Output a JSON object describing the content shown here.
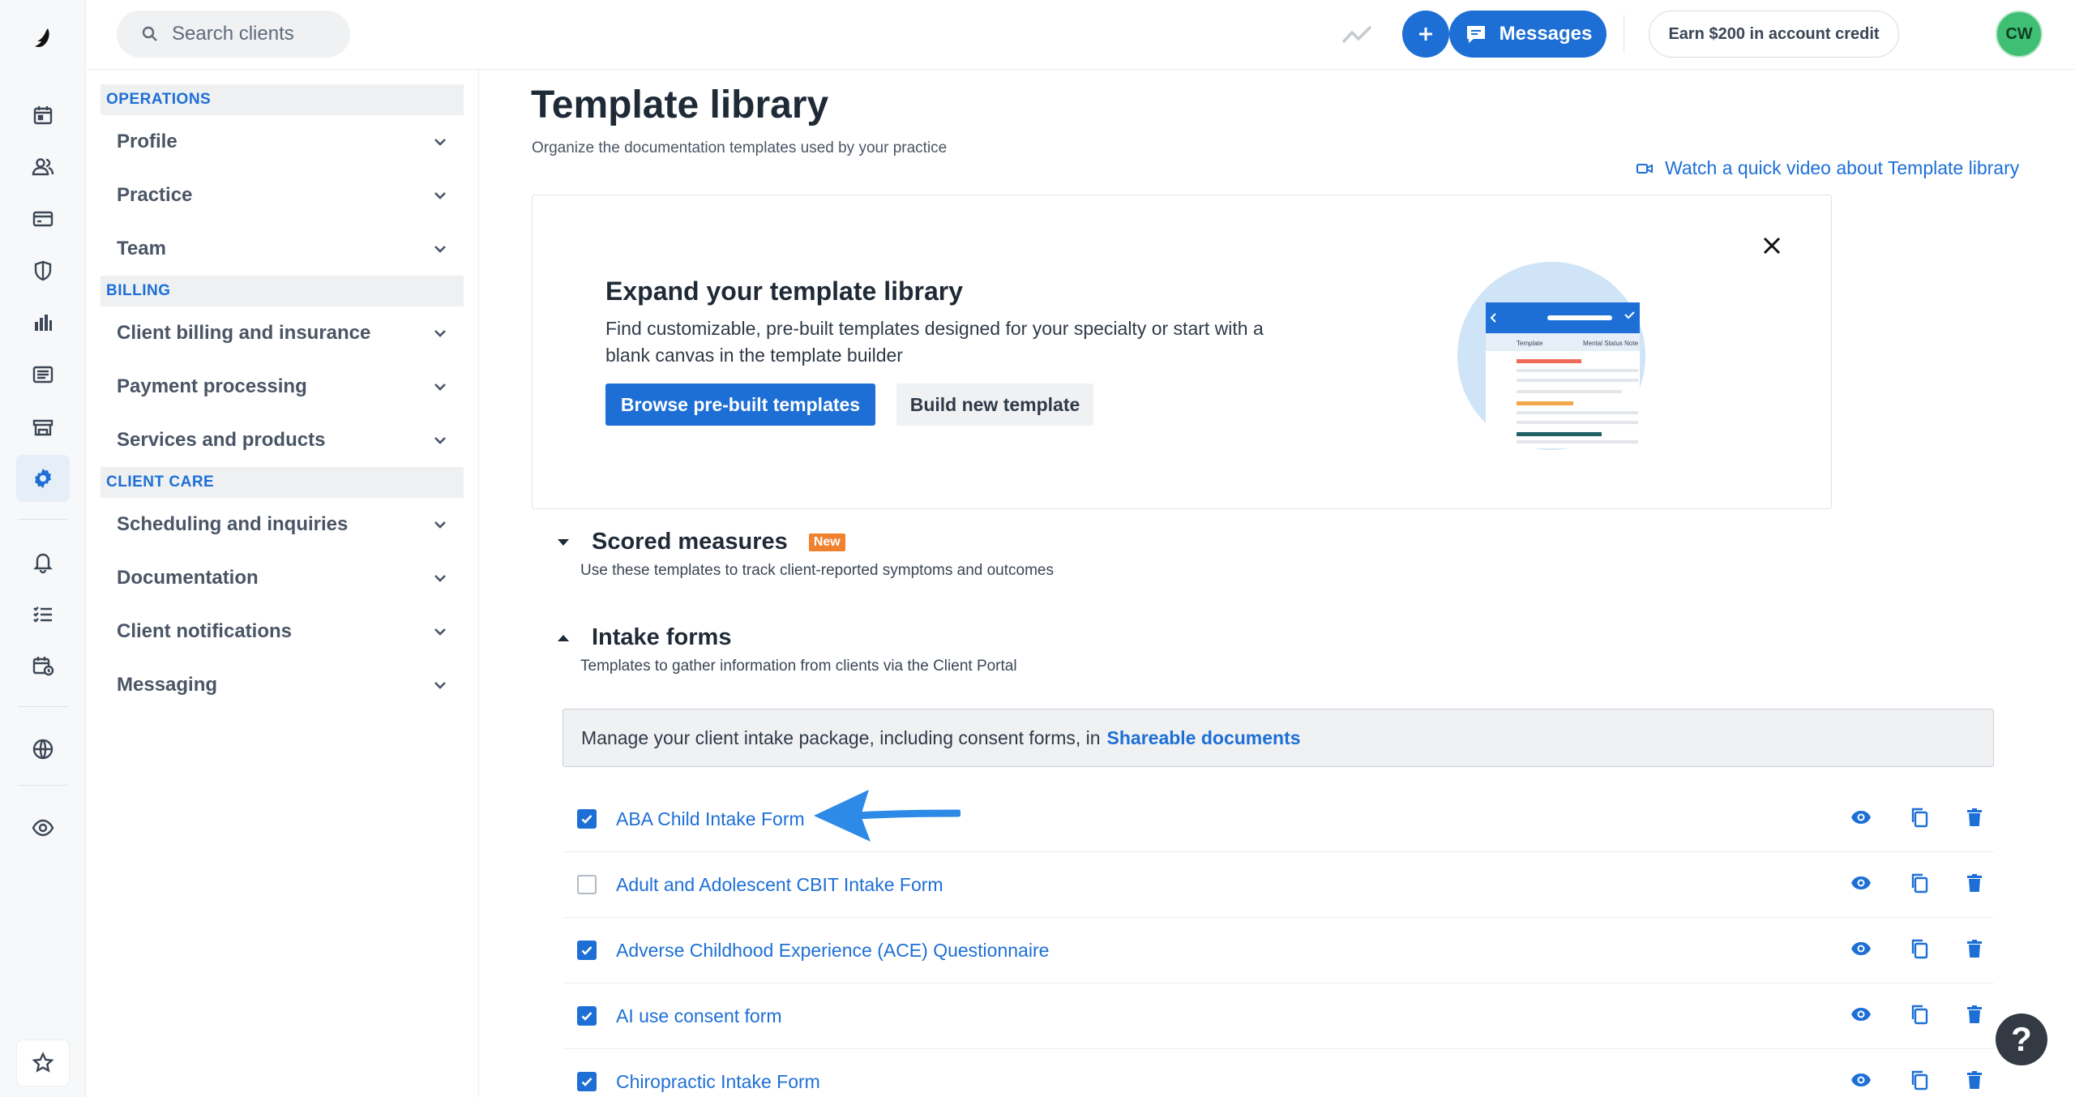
{
  "header": {
    "search_placeholder": "Search clients",
    "messages_label": "Messages",
    "earn_label": "Earn $200 in account credit",
    "avatar_initials": "CW"
  },
  "rail": {
    "icons": [
      "logo-icon",
      "calendar-icon",
      "clients-icon",
      "billing-card-icon",
      "insurance-shield-icon",
      "analytics-icon",
      "list-icon",
      "marketplace-icon",
      "settings-gear-icon",
      "notifications-bell-icon",
      "tasks-icon",
      "reminders-icon",
      "website-globe-icon",
      "view-eye-icon",
      "favorites-star-icon"
    ],
    "active": "settings-gear-icon"
  },
  "settings_nav": {
    "sections": [
      {
        "title": "OPERATIONS",
        "items": [
          {
            "label": "Profile"
          },
          {
            "label": "Practice"
          },
          {
            "label": "Team"
          }
        ]
      },
      {
        "title": "BILLING",
        "items": [
          {
            "label": "Client billing and insurance"
          },
          {
            "label": "Payment processing"
          },
          {
            "label": "Services and products"
          }
        ]
      },
      {
        "title": "CLIENT CARE",
        "items": [
          {
            "label": "Scheduling and inquiries"
          },
          {
            "label": "Documentation"
          },
          {
            "label": "Client notifications"
          },
          {
            "label": "Messaging"
          }
        ]
      }
    ]
  },
  "page": {
    "title": "Template library",
    "subtitle": "Organize the documentation templates used by your practice",
    "video_link": "Watch a quick video about Template library"
  },
  "promo": {
    "title": "Expand your template library",
    "text": "Find customizable, pre-built templates designed for your specialty or start with a blank canvas in the template builder",
    "primary_button": "Browse pre-built templates",
    "secondary_button": "Build new template",
    "illustration": {
      "col_template": "Template",
      "col_note": "Mental Status Note"
    }
  },
  "groups": {
    "scored": {
      "title": "Scored measures",
      "badge": "New",
      "description": "Use these templates to track client-reported symptoms and outcomes",
      "expanded": false
    },
    "intake": {
      "title": "Intake forms",
      "description": "Templates to gather information from clients via the Client Portal",
      "expanded": true
    }
  },
  "info_bar": {
    "text": "Manage your client intake package, including consent forms, in",
    "link": "Shareable documents"
  },
  "templates": [
    {
      "name": "ABA Child Intake Form",
      "checked": true
    },
    {
      "name": "Adult and Adolescent CBIT Intake Form",
      "checked": false
    },
    {
      "name": "Adverse Childhood Experience (ACE) Questionnaire",
      "checked": true
    },
    {
      "name": "AI use consent form",
      "checked": true
    },
    {
      "name": "Chiropractic Intake Form",
      "checked": true
    }
  ],
  "colors": {
    "accent": "#1d6fd6",
    "badge_new": "#f0822f",
    "avatar": "#3fbf73"
  },
  "help_label": "?"
}
